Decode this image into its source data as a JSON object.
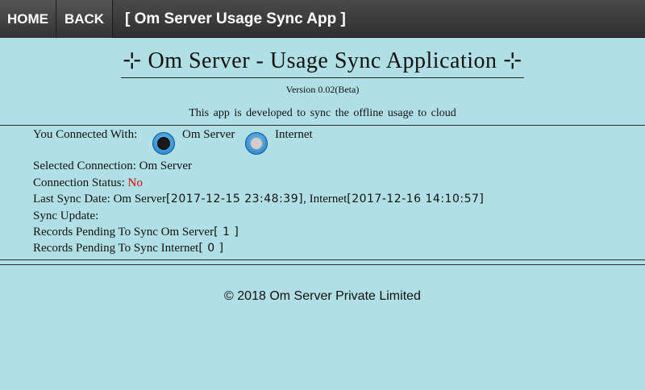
{
  "nav": {
    "home_label": "HOME",
    "back_label": "BACK",
    "app_title": "[ Om Server Usage Sync App ]"
  },
  "header": {
    "title": "⊹ Om Server - Usage Sync Application ⊹",
    "version": "Version 0.02(Beta)",
    "tagline": "This app is developed to sync the offline usage to cloud"
  },
  "connection": {
    "label": "You Connected With:",
    "options": [
      {
        "label": "Om Server",
        "selected": true
      },
      {
        "label": "Internet",
        "selected": false
      }
    ],
    "selected_label": "Selected Connection:",
    "selected_value": "Om Server",
    "status_label": "Connection Status:",
    "status_value": "No",
    "status_color": "#e00000"
  },
  "sync": {
    "last_sync_label": "Last Sync Date:",
    "om_server_label": "Om Server",
    "om_server_date": "[2017-12-15 23:48:39]",
    "internet_label": ", Internet",
    "internet_date": "[2017-12-16 14:10:57]",
    "update_label": "Sync Update:",
    "pending_om_label": "Records Pending To Sync Om Server",
    "pending_om_value": "[ 1 ]",
    "pending_internet_label": "Records Pending To Sync Internet",
    "pending_internet_value": "[ 0 ]"
  },
  "footer": {
    "copyright": "© 2018 Om Server Private Limited"
  },
  "colors": {
    "background": "#b0dfe5",
    "topbar": "#3a3a3a",
    "radio_accent": "#1f7ac8"
  }
}
